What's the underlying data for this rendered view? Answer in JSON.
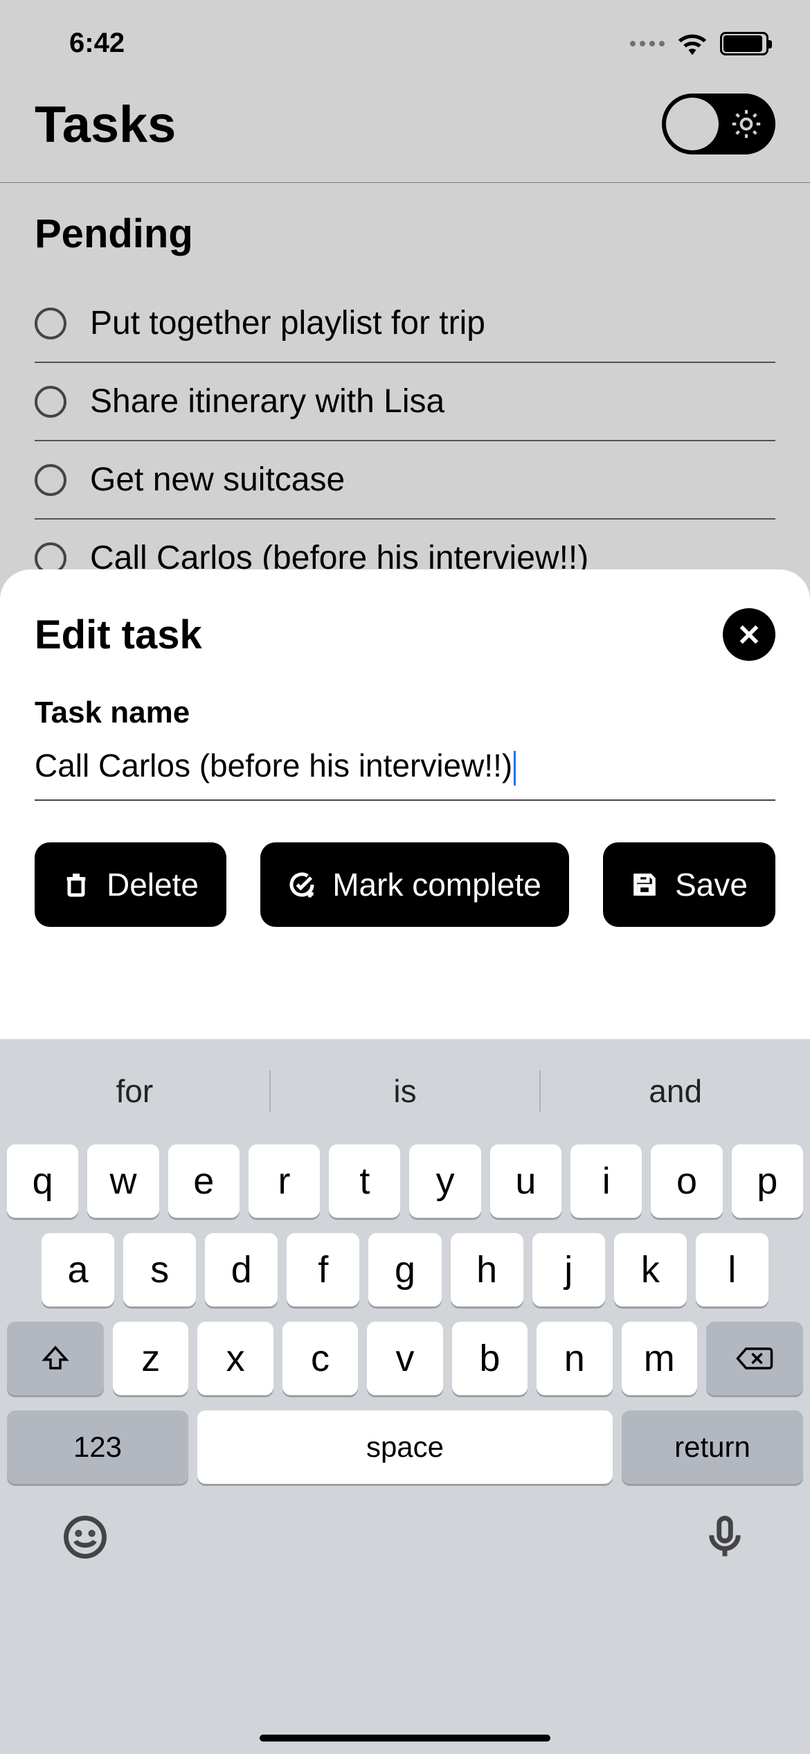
{
  "status": {
    "time": "6:42"
  },
  "header": {
    "title": "Tasks"
  },
  "pending": {
    "title": "Pending",
    "tasks": [
      "Put together playlist for trip",
      "Share itinerary with Lisa",
      "Get new suitcase",
      "Call Carlos (before his interview!!)"
    ]
  },
  "sheet": {
    "title": "Edit task",
    "field_label": "Task name",
    "value": "Call Carlos (before his interview!!)",
    "buttons": {
      "delete": "Delete",
      "complete": "Mark complete",
      "save": "Save"
    }
  },
  "keyboard": {
    "suggestions": [
      "for",
      "is",
      "and"
    ],
    "row1": [
      "q",
      "w",
      "e",
      "r",
      "t",
      "y",
      "u",
      "i",
      "o",
      "p"
    ],
    "row2": [
      "a",
      "s",
      "d",
      "f",
      "g",
      "h",
      "j",
      "k",
      "l"
    ],
    "row3": [
      "z",
      "x",
      "c",
      "v",
      "b",
      "n",
      "m"
    ],
    "num": "123",
    "space": "space",
    "ret": "return"
  }
}
